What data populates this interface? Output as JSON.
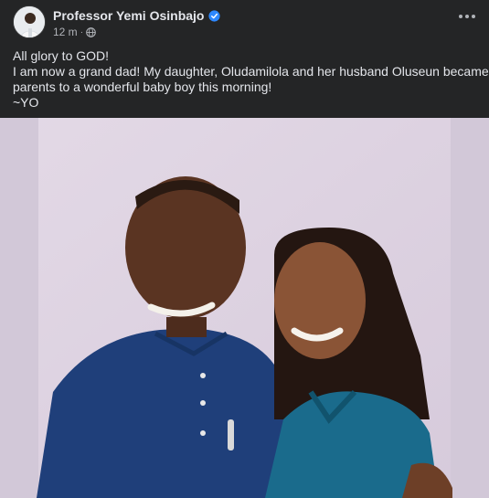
{
  "post": {
    "author": "Professor Yemi Osinbajo",
    "timestamp": "12 m",
    "text_lines": [
      "All glory to GOD!",
      "I am now a grand dad! My daughter, Oludamilola and her husband Oluseun became",
      "parents to a wonderful baby boy this morning!",
      "~YO"
    ],
    "icons": {
      "verified": "verified-badge-icon",
      "privacy": "globe-icon",
      "more": "more-options-icon"
    }
  },
  "colors": {
    "background": "#242526",
    "text": "#e4e6eb",
    "secondary_text": "#b0b3b8",
    "verified_blue": "#2d88ff",
    "photo_background": "#ddd2e0"
  }
}
